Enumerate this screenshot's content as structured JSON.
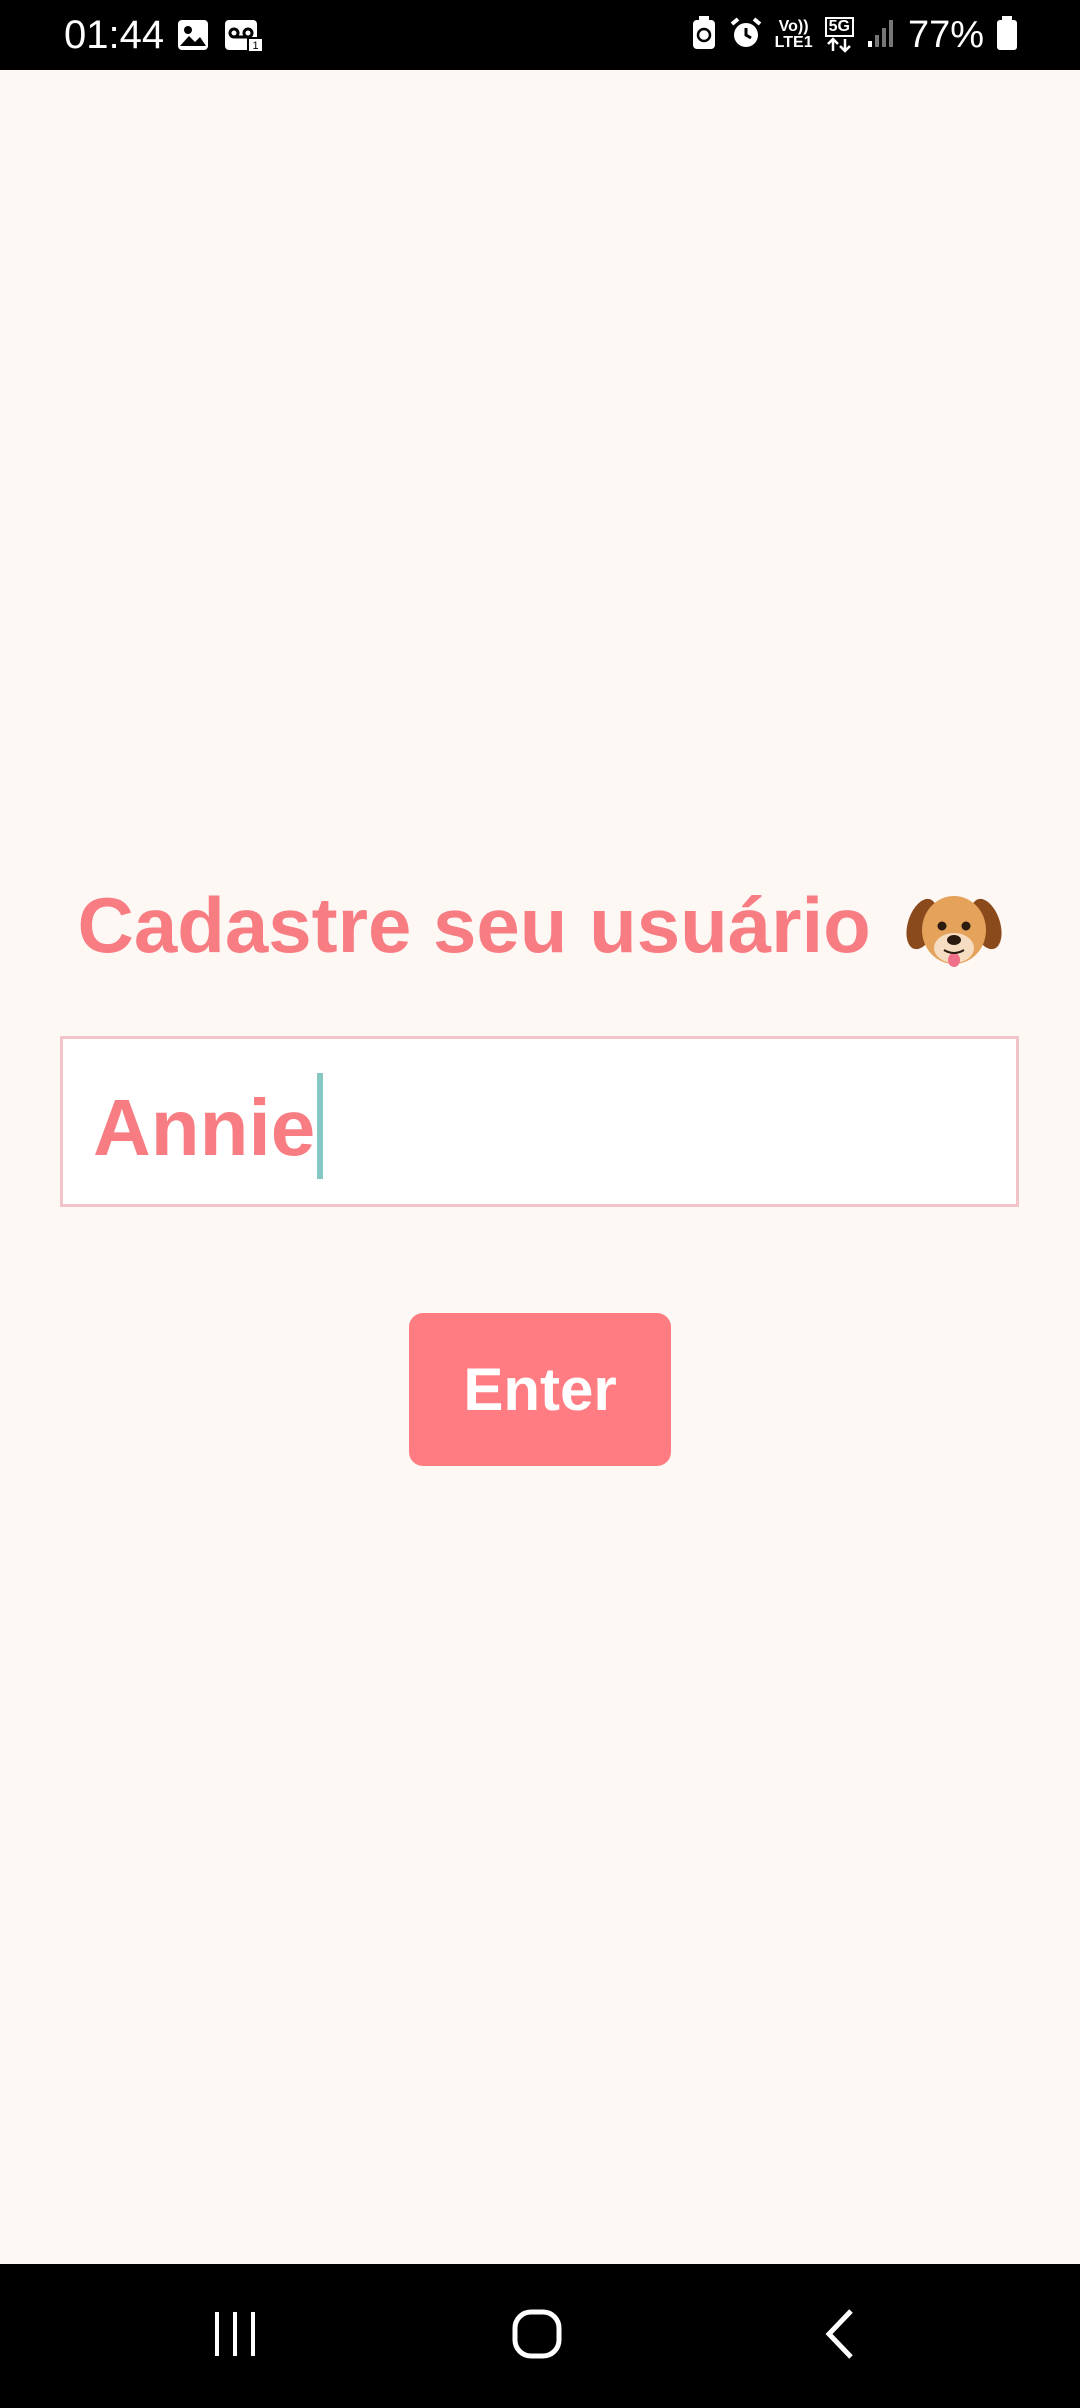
{
  "status_bar": {
    "time": "01:44",
    "network_top": "Vo))",
    "network_bottom": "LTE1",
    "signal_type": "5G",
    "battery_percent": "77%",
    "icons": [
      "gallery-icon",
      "voicemail-icon",
      "battery-saver-icon",
      "alarm-icon",
      "volte-icon",
      "5g-icon",
      "signal-icon",
      "battery-icon"
    ]
  },
  "main": {
    "title": "Cadastre seu usuário",
    "title_icon": "dog-face-icon",
    "username_input": {
      "value": "Annie"
    },
    "enter_button_label": "Enter"
  },
  "nav_bar": {
    "icons": [
      "recent-apps-icon",
      "home-icon",
      "back-icon"
    ]
  },
  "colors": {
    "accent": "#f77d83",
    "button": "#ff7c82",
    "background": "#fef8f5",
    "input_border": "#f2c3c8",
    "cursor": "#86c7c4"
  }
}
